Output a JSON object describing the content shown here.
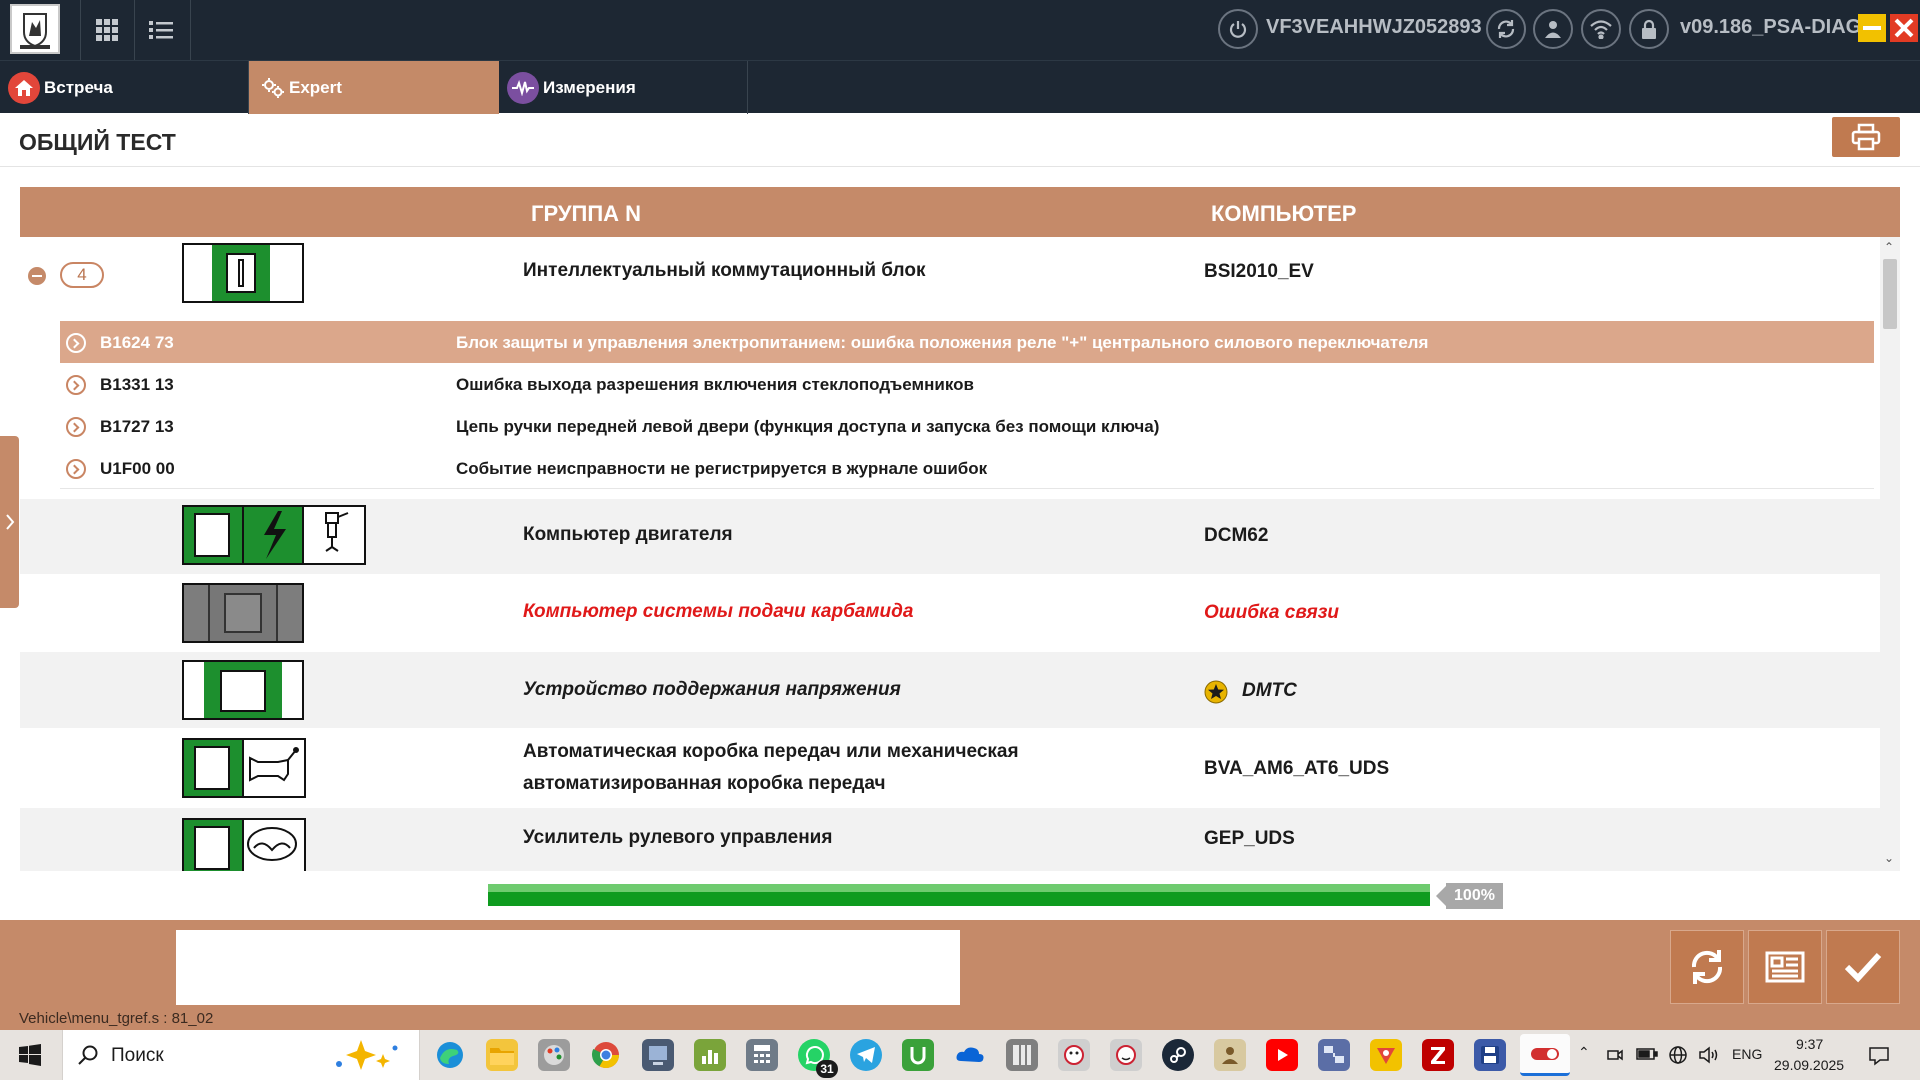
{
  "titlebar": {
    "vin": "VF3VEAHHWJZ052893",
    "version": "v09.186_PSA-DIAG"
  },
  "tabs": [
    {
      "label": "Встреча"
    },
    {
      "label": "Expert",
      "active": true
    },
    {
      "label": "Измерения"
    }
  ],
  "page": {
    "title": "ОБЩИЙ ТЕСТ"
  },
  "table": {
    "headers": {
      "group": "ГРУППА N",
      "computer": "КОМПЬЮТЕР"
    },
    "expanded_group": {
      "fault_count": "4",
      "name": "Интеллектуальный коммутационный блок",
      "computer": "BSI2010_EV",
      "faults": [
        {
          "code": "B1624 73",
          "desc": "Блок защиты и управления электропитанием: ошибка положения реле \"+\" центрального силового переключателя",
          "highlighted": true
        },
        {
          "code": "B1331 13",
          "desc": "Ошибка выхода разрешения включения стеклоподъемников"
        },
        {
          "code": "B1727 13",
          "desc": "Цепь ручки передней левой двери (функция доступа и запуска без помощи ключа)"
        },
        {
          "code": "U1F00 00",
          "desc": "Событие неисправности не регистрируется в журнале ошибок"
        }
      ]
    },
    "rows": [
      {
        "name": "Компьютер двигателя",
        "computer": "DCM62"
      },
      {
        "name": "Компьютер системы подачи карбамида",
        "computer": "Ошибка связи",
        "status": "error"
      },
      {
        "name": "Устройство поддержания напряжения",
        "computer": "DMTC",
        "status": "star"
      },
      {
        "name_line1": "Автоматическая коробка передач или механическая",
        "name_line2": "автоматизированная коробка передач",
        "computer": "BVA_AM6_AT6_UDS"
      },
      {
        "name": "Усилитель рулевого управления",
        "computer": "GEP_UDS"
      }
    ]
  },
  "progress": {
    "value": 100,
    "label": "100%"
  },
  "bottom": {
    "path": "Vehicle\\menu_tgref.s : 81_02"
  },
  "taskbar": {
    "search_placeholder": "Поиск",
    "whatsapp_badge": "31",
    "language": "ENG",
    "time": "9:37",
    "date": "29.09.2025"
  },
  "colors": {
    "accent": "#c58a69",
    "highlight_row": "#dba78b",
    "error_text": "#e01919",
    "progress": "#0e9b1f",
    "topbar": "#1d2733"
  }
}
